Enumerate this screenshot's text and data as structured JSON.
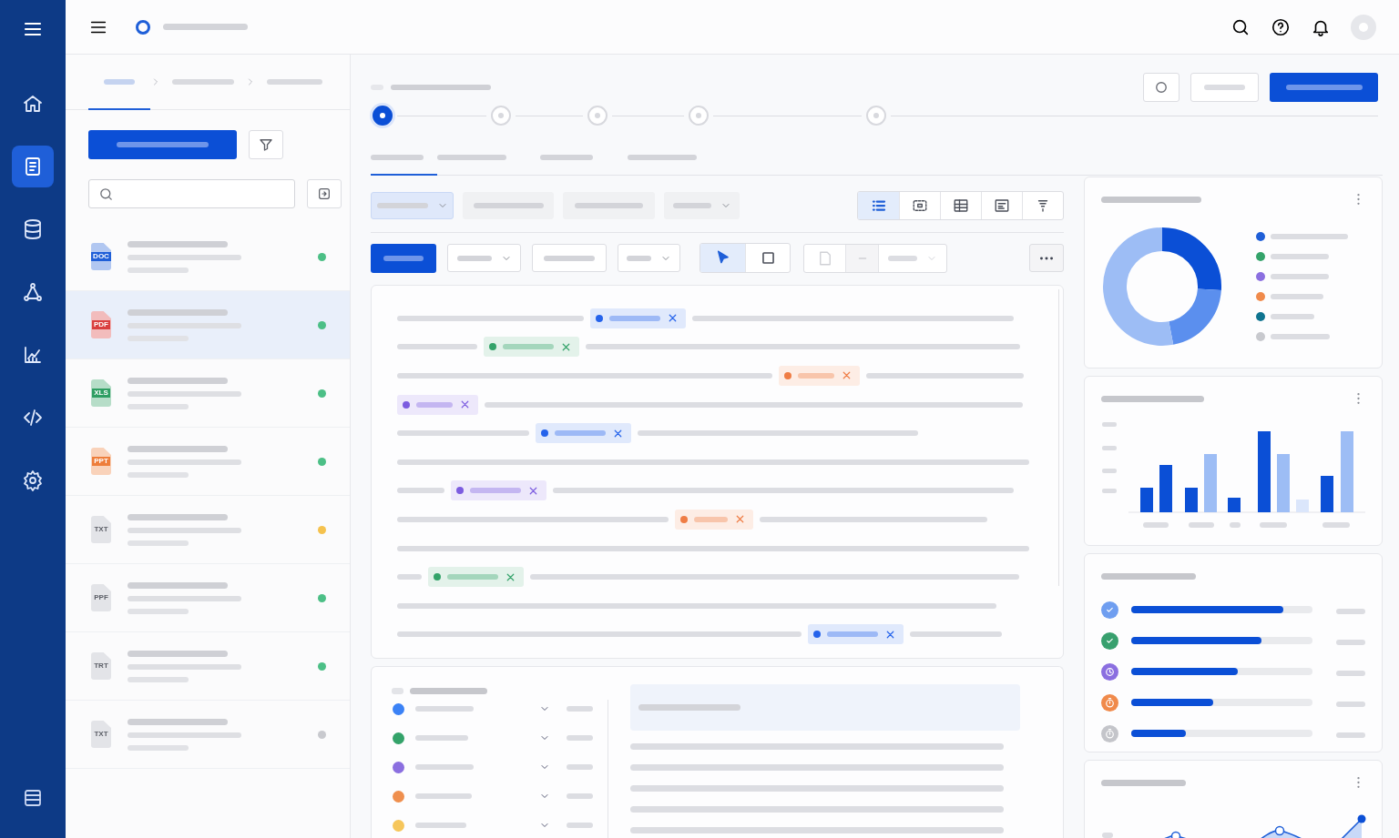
{
  "rail": [
    {
      "kind": "home",
      "selected": false
    },
    {
      "kind": "document",
      "selected": true
    },
    {
      "kind": "database",
      "selected": false
    },
    {
      "kind": "network",
      "selected": false
    },
    {
      "kind": "chart",
      "selected": false
    },
    {
      "kind": "code",
      "selected": false
    },
    {
      "kind": "settings",
      "selected": false
    }
  ],
  "sidebar": {
    "breadcrumb": [
      {
        "selected": true
      },
      {
        "selected": false
      },
      {
        "selected": false
      }
    ],
    "files": [
      {
        "label": "DOC",
        "kind": "colored",
        "color": "#1f5fd8",
        "status": {
          "color": "#4cbf86"
        },
        "selected": false
      },
      {
        "label": "PDF",
        "kind": "colored",
        "color": "#d93f3f",
        "status": {
          "color": "#4cbf86"
        },
        "selected": true
      },
      {
        "label": "XLS",
        "kind": "colored",
        "color": "#2f9e63",
        "status": {
          "color": "#4cbf86"
        },
        "selected": false
      },
      {
        "label": "PPT",
        "kind": "colored",
        "color": "#ee7d3a",
        "status": {
          "color": "#4cbf86"
        },
        "selected": false
      },
      {
        "label": "TXT",
        "kind": "plain",
        "color": "#5b5e66",
        "status": {
          "color": "#f5c24e"
        },
        "selected": false
      },
      {
        "label": "PPF",
        "kind": "plain",
        "color": "#5b5e66",
        "status": {
          "color": "#4cbf86"
        },
        "selected": false
      },
      {
        "label": "TRT",
        "kind": "plain",
        "color": "#5b5e66",
        "status": {
          "color": "#4cbf86"
        },
        "selected": false
      },
      {
        "label": "TXT",
        "kind": "plain",
        "color": "#5b5e66",
        "status": {
          "color": "#c8c9ce"
        },
        "selected": false
      }
    ]
  },
  "stepper": [
    {
      "selected": true
    },
    {
      "selected": false
    },
    {
      "selected": false
    },
    {
      "selected": false
    },
    {
      "selected": false
    }
  ],
  "tabs": [
    {
      "selected": true
    },
    {
      "selected": false
    },
    {
      "selected": false
    },
    {
      "selected": false
    }
  ],
  "filters": [
    {
      "kind": "dropdown",
      "selected": true
    },
    {
      "kind": "chip",
      "selected": false
    },
    {
      "kind": "chip",
      "selected": false
    },
    {
      "kind": "dropdown",
      "selected": false
    }
  ],
  "view_modes": [
    {
      "kind": "list",
      "selected": true
    },
    {
      "kind": "frame",
      "selected": false
    },
    {
      "kind": "table",
      "selected": false
    },
    {
      "kind": "form",
      "selected": false
    },
    {
      "kind": "funnel",
      "selected": false
    }
  ],
  "tools": [
    {
      "kind": "pointer",
      "selected": true
    },
    {
      "kind": "rectangle",
      "selected": false
    }
  ],
  "tags": [
    {
      "color": "#2563eb"
    },
    {
      "color": "#34a36a"
    },
    {
      "color": "#ef7d45"
    },
    {
      "color": "#7c5ce0"
    },
    {
      "color": "#2563eb"
    },
    {
      "color": "#7c5ce0"
    },
    {
      "color": "#ef7d45"
    },
    {
      "color": "#34a36a"
    },
    {
      "color": "#2563eb"
    }
  ],
  "legend": [
    {
      "color": "#1f5fd8"
    },
    {
      "color": "#34a36a"
    },
    {
      "color": "#8b6fe0"
    },
    {
      "color": "#f08a4b"
    },
    {
      "color": "#0f7490"
    },
    {
      "color": "#c8c9ce"
    }
  ],
  "progress": [
    {
      "kind": "check",
      "color": "#6f9ef0",
      "level": 0.84
    },
    {
      "kind": "check",
      "color": "#38a06e",
      "level": 0.72
    },
    {
      "kind": "clock",
      "color": "#8b6fe0",
      "level": 0.59
    },
    {
      "kind": "timer",
      "color": "#f08a4b",
      "level": 0.45
    },
    {
      "kind": "timer",
      "color": "#c4c5ca",
      "level": 0.3
    }
  ],
  "bottom_list": [
    {
      "color": "#3b82f6"
    },
    {
      "color": "#34a36a"
    },
    {
      "color": "#8b6fe0"
    },
    {
      "color": "#ef8f4e"
    },
    {
      "color": "#f6c65b"
    }
  ]
}
